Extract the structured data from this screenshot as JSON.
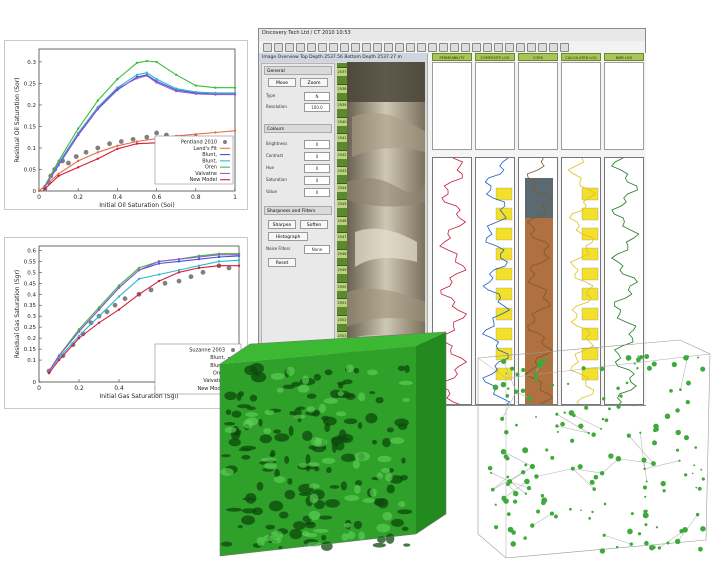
{
  "chart_data": [
    {
      "type": "line",
      "xlabel": "Initial Oil Saturation (Soi)",
      "ylabel": "Residual Oil Saturation (Sor)",
      "xlim": [
        0,
        1
      ],
      "ylim": [
        0,
        0.33
      ],
      "xticks": [
        "0",
        "0.2",
        "0.4",
        "0.6",
        "0.8",
        "1"
      ],
      "yticks": [
        "0",
        "0.05",
        "0.1",
        "0.15",
        "0.2",
        "0.25",
        "0.3"
      ],
      "legend": "bottom-right",
      "grid": false,
      "series": [
        {
          "name": "Pentland 2010",
          "kind": "scatter",
          "color": "#808080",
          "x": [
            0.03,
            0.05,
            0.06,
            0.08,
            0.12,
            0.15,
            0.19,
            0.24,
            0.3,
            0.36,
            0.42,
            0.48,
            0.55,
            0.6,
            0.65,
            0.72,
            0.8,
            0.88
          ],
          "y": [
            0.005,
            0.02,
            0.035,
            0.05,
            0.07,
            0.065,
            0.08,
            0.09,
            0.1,
            0.11,
            0.115,
            0.12,
            0.125,
            0.135,
            0.13,
            0.12,
            0.125,
            0.115
          ]
        },
        {
          "name": "Land's Fit",
          "color": "#e0704a",
          "x": [
            0,
            0.1,
            0.2,
            0.3,
            0.4,
            0.5,
            0.6,
            0.7,
            0.8,
            0.9,
            1.0
          ],
          "y": [
            0,
            0.04,
            0.07,
            0.09,
            0.105,
            0.115,
            0.122,
            0.128,
            0.132,
            0.136,
            0.14
          ]
        },
        {
          "name": "Blunt,",
          "color": "#3a56d8",
          "x": [
            0.03,
            0.1,
            0.2,
            0.3,
            0.4,
            0.5,
            0.55,
            0.6,
            0.7,
            0.8,
            0.9,
            1.0
          ],
          "y": [
            0.01,
            0.06,
            0.13,
            0.19,
            0.235,
            0.265,
            0.27,
            0.255,
            0.235,
            0.228,
            0.225,
            0.225
          ]
        },
        {
          "name": "Blunt,",
          "color": "#2fb8c8",
          "x": [
            0.03,
            0.1,
            0.2,
            0.3,
            0.4,
            0.5,
            0.55,
            0.6,
            0.7,
            0.8,
            0.9,
            1.0
          ],
          "y": [
            0.01,
            0.065,
            0.135,
            0.195,
            0.24,
            0.27,
            0.275,
            0.26,
            0.238,
            0.23,
            0.228,
            0.228
          ]
        },
        {
          "name": "Oren",
          "color": "#3bbd3b",
          "x": [
            0.03,
            0.1,
            0.2,
            0.3,
            0.4,
            0.5,
            0.55,
            0.6,
            0.7,
            0.8,
            0.9,
            1.0
          ],
          "y": [
            0.012,
            0.07,
            0.145,
            0.21,
            0.26,
            0.298,
            0.302,
            0.3,
            0.27,
            0.245,
            0.24,
            0.24
          ]
        },
        {
          "name": "Valvatne",
          "color": "#9a5ad0",
          "x": [
            0.03,
            0.1,
            0.2,
            0.3,
            0.4,
            0.5,
            0.55,
            0.6,
            0.7,
            0.8,
            0.9,
            1.0
          ],
          "y": [
            0.01,
            0.062,
            0.132,
            0.192,
            0.238,
            0.262,
            0.268,
            0.252,
            0.232,
            0.226,
            0.224,
            0.224
          ]
        },
        {
          "name": "New Model",
          "color": "#d0203a",
          "x": [
            0.03,
            0.1,
            0.2,
            0.3,
            0.4,
            0.5,
            0.6,
            0.7,
            0.8,
            0.9
          ],
          "y": [
            0.005,
            0.035,
            0.055,
            0.075,
            0.098,
            0.11,
            0.112,
            0.108,
            0.11,
            0.11
          ]
        }
      ]
    },
    {
      "type": "line",
      "xlabel": "Initial Gas Saturation (Sgi)",
      "ylabel": "Residual Gas Saturation (Sgr)",
      "xlim": [
        0,
        1
      ],
      "ylim": [
        0,
        0.62
      ],
      "xticks": [
        "0",
        "0.2",
        "0.4",
        "0.6",
        "0.8"
      ],
      "yticks": [
        "0",
        "0.1",
        "0.15",
        "0.2",
        "0.25",
        "0.3",
        "0.35",
        "0.4",
        "0.45",
        "0.5",
        "0.55",
        "0.6"
      ],
      "legend": "bottom-right",
      "grid": false,
      "series": [
        {
          "name": "Suzanne 2003",
          "kind": "scatter",
          "color": "#808080",
          "x": [
            0.05,
            0.12,
            0.17,
            0.22,
            0.26,
            0.3,
            0.34,
            0.38,
            0.43,
            0.5,
            0.56,
            0.63,
            0.7,
            0.76,
            0.82,
            0.9,
            0.95
          ],
          "y": [
            0.05,
            0.12,
            0.17,
            0.22,
            0.27,
            0.3,
            0.32,
            0.35,
            0.38,
            0.4,
            0.42,
            0.45,
            0.46,
            0.48,
            0.5,
            0.53,
            0.52
          ]
        },
        {
          "name": "Blunt,",
          "color": "#3a56d8",
          "x": [
            0.05,
            0.1,
            0.2,
            0.3,
            0.4,
            0.5,
            0.6,
            0.7,
            0.8,
            0.9,
            1.0
          ],
          "y": [
            0.05,
            0.12,
            0.23,
            0.33,
            0.43,
            0.51,
            0.54,
            0.55,
            0.56,
            0.57,
            0.575
          ]
        },
        {
          "name": "Blunt,",
          "color": "#2fb8c8",
          "x": [
            0.05,
            0.1,
            0.2,
            0.3,
            0.4,
            0.5,
            0.6,
            0.7,
            0.8,
            0.9,
            1.0
          ],
          "y": [
            0.05,
            0.11,
            0.21,
            0.3,
            0.39,
            0.47,
            0.49,
            0.51,
            0.53,
            0.55,
            0.555
          ]
        },
        {
          "name": "Oren",
          "color": "#3bbd3b",
          "x": [
            0.05,
            0.1,
            0.2,
            0.3,
            0.4,
            0.5,
            0.6,
            0.7,
            0.8,
            0.9,
            1.0
          ],
          "y": [
            0.05,
            0.12,
            0.24,
            0.34,
            0.44,
            0.52,
            0.55,
            0.56,
            0.575,
            0.585,
            0.585
          ]
        },
        {
          "name": "Valvatne",
          "color": "#9a5ad0",
          "x": [
            0.05,
            0.1,
            0.2,
            0.3,
            0.4,
            0.5,
            0.6,
            0.7,
            0.8,
            0.9,
            1.0
          ],
          "y": [
            0.05,
            0.12,
            0.23,
            0.33,
            0.43,
            0.51,
            0.55,
            0.56,
            0.57,
            0.58,
            0.58
          ]
        },
        {
          "name": "New Model",
          "color": "#d0203a",
          "x": [
            0.05,
            0.1,
            0.2,
            0.3,
            0.4,
            0.5,
            0.6,
            0.7,
            0.8,
            0.9,
            1.0
          ],
          "y": [
            0.04,
            0.1,
            0.2,
            0.27,
            0.33,
            0.4,
            0.46,
            0.5,
            0.52,
            0.53,
            0.53
          ]
        }
      ]
    }
  ],
  "core_viewer": {
    "title": "Discovery Tech Ltd / CT 2010 10:53",
    "subwindow_title": "Image Overview Top Depth 2537.56 Bottom Depth 2537.27 m",
    "sections": {
      "general": "General",
      "colours": "Colours",
      "sharpness": "Sharpness and Filters"
    },
    "general_buttons": [
      "Move",
      "Zoom"
    ],
    "general_fields": [
      {
        "label": "Type",
        "value": "N"
      },
      {
        "label": "Resolution",
        "value": "100.0"
      }
    ],
    "colour_fields": [
      {
        "label": "Brightness",
        "value": "0"
      },
      {
        "label": "Contrast",
        "value": "0"
      },
      {
        "label": "Hue",
        "value": "0"
      },
      {
        "label": "Saturation",
        "value": "0"
      },
      {
        "label": "Value",
        "value": "0"
      }
    ],
    "filter_buttons": [
      "Sharpen",
      "Soften",
      "Histograph",
      "Reset"
    ],
    "filter_field": {
      "label": "Noise Filters",
      "value": "None"
    },
    "track_headers": [
      "PERMEABILITY",
      "COMPOSITE LOG",
      "CORE",
      "CALCULATED LOG",
      "NMR LOG"
    ],
    "depth_ticks": [
      "2537",
      "2538",
      "2539",
      "2540",
      "2541",
      "2542",
      "2543",
      "2544",
      "2545",
      "2546",
      "2547",
      "2548",
      "2549",
      "2550",
      "2551",
      "2552",
      "2553",
      "2554",
      "2555",
      "2556"
    ]
  },
  "renders": {
    "pore_volume": {
      "color": "#2fa02a"
    },
    "pore_network": {
      "node_color": "#3daa3a",
      "throat_color": "#b8b8b8"
    }
  },
  "colors": {
    "axis": "#333333",
    "panel_bg": "#ffffff",
    "viewer_green": "#a9c55a"
  }
}
